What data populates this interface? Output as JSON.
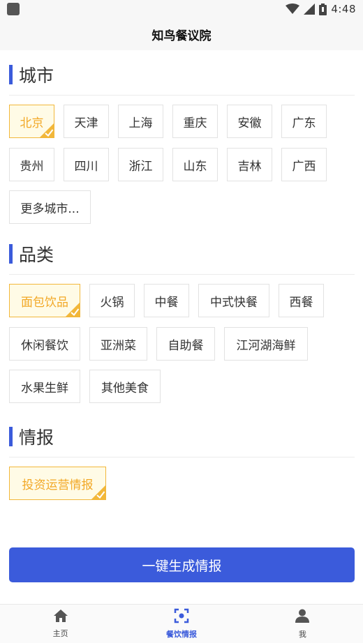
{
  "status_bar": {
    "time": "4:48"
  },
  "header": {
    "title": "知鸟餐议院"
  },
  "sections": {
    "city": {
      "title": "城市",
      "items": [
        {
          "label": "北京",
          "selected": true
        },
        {
          "label": "天津",
          "selected": false
        },
        {
          "label": "上海",
          "selected": false
        },
        {
          "label": "重庆",
          "selected": false
        },
        {
          "label": "安徽",
          "selected": false
        },
        {
          "label": "广东",
          "selected": false
        },
        {
          "label": "贵州",
          "selected": false
        },
        {
          "label": "四川",
          "selected": false
        },
        {
          "label": "浙江",
          "selected": false
        },
        {
          "label": "山东",
          "selected": false
        },
        {
          "label": "吉林",
          "selected": false
        },
        {
          "label": "广西",
          "selected": false
        },
        {
          "label": "更多城市...",
          "selected": false
        }
      ]
    },
    "category": {
      "title": "品类",
      "items": [
        {
          "label": "面包饮品",
          "selected": true
        },
        {
          "label": "火锅",
          "selected": false
        },
        {
          "label": "中餐",
          "selected": false
        },
        {
          "label": "中式快餐",
          "selected": false
        },
        {
          "label": "西餐",
          "selected": false
        },
        {
          "label": "休闲餐饮",
          "selected": false
        },
        {
          "label": "亚洲菜",
          "selected": false
        },
        {
          "label": "自助餐",
          "selected": false
        },
        {
          "label": "江河湖海鲜",
          "selected": false
        },
        {
          "label": "水果生鲜",
          "selected": false
        },
        {
          "label": "其他美食",
          "selected": false
        }
      ]
    },
    "report": {
      "title": "情报",
      "items": [
        {
          "label": "投资运营情报",
          "selected": true
        }
      ]
    }
  },
  "generate_button": {
    "label": "一键生成情报"
  },
  "bottom_nav": {
    "items": [
      {
        "label": "主页",
        "icon": "home-icon",
        "active": false
      },
      {
        "label": "餐饮情报",
        "icon": "report-icon",
        "active": true
      },
      {
        "label": "我",
        "icon": "user-icon",
        "active": false
      }
    ]
  },
  "colors": {
    "accent": "#3b5bdb",
    "selected_text": "#f2a826",
    "selected_border": "#f2b73a",
    "selected_bg": "#fffbe6"
  }
}
